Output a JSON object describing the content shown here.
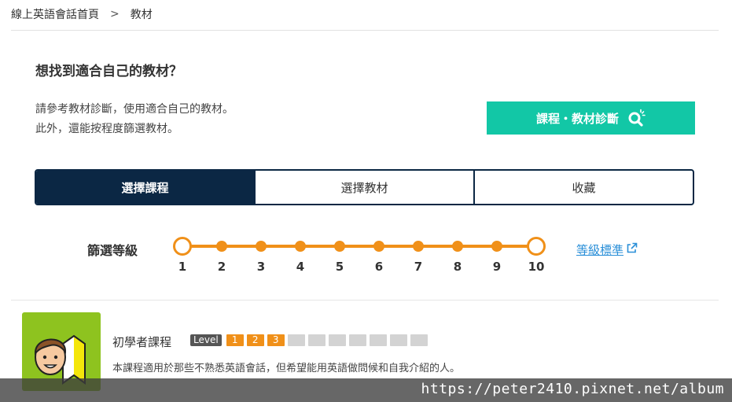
{
  "breadcrumb": {
    "home": "線上英語會話首頁",
    "separator": ">",
    "current": "教材"
  },
  "heading": "想找到適合自己的教材？",
  "description": {
    "line1": "請參考教材診斷，使用適合自己的教材。",
    "line2": "此外，還能按程度篩選教材。"
  },
  "diagnosis_button": {
    "label": "課程・教材診斷",
    "icon": "magnifier-sparkle-icon"
  },
  "tabs": [
    {
      "label": "選擇課程",
      "active": true
    },
    {
      "label": "選擇教材",
      "active": false
    },
    {
      "label": "收藏",
      "active": false
    }
  ],
  "filter": {
    "label": "篩選等級",
    "levels": [
      "1",
      "2",
      "3",
      "4",
      "5",
      "6",
      "7",
      "8",
      "9",
      "10"
    ],
    "selected_min": "1",
    "selected_max": "10",
    "link_label": "等級標準",
    "link_icon": "external-link-icon"
  },
  "course": {
    "title": "初學者課程",
    "level_badge": "Level",
    "levels_on": [
      "1",
      "2",
      "3"
    ],
    "levels_total": 10,
    "description": "本課程適用於那些不熟悉英語會話，但希望能用英語做問候和自我介紹的人。",
    "thumb_icon": "beginner-boy-icon"
  },
  "watermark": "https://peter2410.pixnet.net/album",
  "colors": {
    "accent_teal": "#12c7a6",
    "navy": "#0b2744",
    "orange": "#f09019",
    "link_blue": "#2a8fd8",
    "thumb_green": "#8ec31f"
  }
}
